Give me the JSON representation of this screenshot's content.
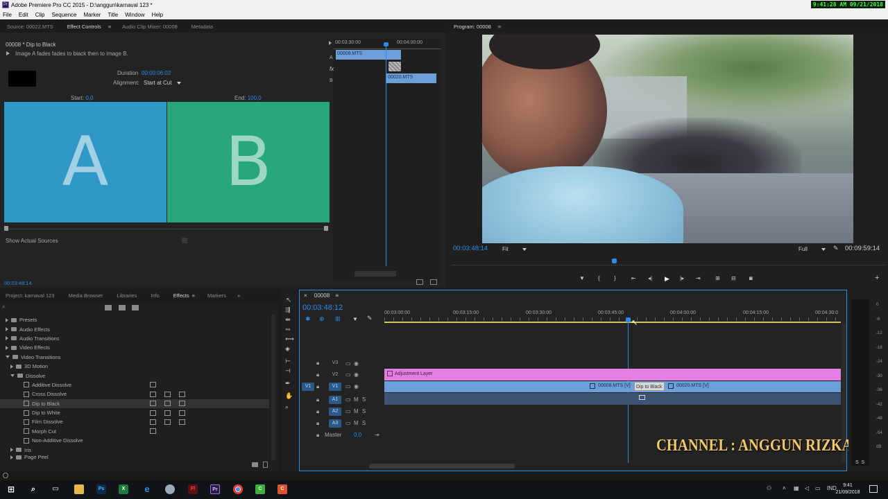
{
  "window": {
    "title": "Adobe Premiere Pro CC 2015 - D:\\anggun\\karnaval 123 *",
    "clock": "9:41:28 AM 09/21/2018",
    "app_badge": "Pr"
  },
  "menu": [
    "File",
    "Edit",
    "Clip",
    "Sequence",
    "Marker",
    "Title",
    "Window",
    "Help"
  ],
  "source_panel": {
    "tabs": [
      "Source: 00022.MTS",
      "Effect Controls",
      "Audio Clip Mixer: 00008",
      "Metadata"
    ],
    "clip_title": "00008 * Dip to Black",
    "description": "Image A fades fades to black then to image B.",
    "duration_label": "Duration",
    "duration_value": "00:00:06:02",
    "alignment_label": "Alignment:",
    "alignment_value": "Start at Cut",
    "start_label": "Start:",
    "start_value": "0,0",
    "end_label": "End:",
    "end_value": "100,0",
    "preview_a": "A",
    "preview_b": "B",
    "show_actual_sources": "Show Actual Sources",
    "mini_timeline_times": [
      "00:03:30:00",
      "00:04:00:00"
    ],
    "track_a_label": "A",
    "track_b_label": "B",
    "fx_label": "fx",
    "clip_a": "00008.MTS",
    "clip_b": "00020.MTS",
    "timecode": "00:03:48:14"
  },
  "program_panel": {
    "tab": "Program: 00008",
    "timecode_left": "00:03:48:14",
    "fit": "Fit",
    "quality": "Full",
    "timecode_right": "00:09:59:14",
    "controls": [
      "marker-icon",
      "in-point-icon",
      "out-point-icon",
      "go-to-in-icon",
      "step-back-icon",
      "play-icon",
      "step-forward-icon",
      "go-to-out-icon",
      "lift-icon",
      "extract-icon",
      "export-frame-icon"
    ]
  },
  "project_panel": {
    "tabs": [
      "Project: karnaval 123",
      "Media Browser",
      "Libraries",
      "Info",
      "Effects",
      "Markers"
    ],
    "active_tab": "Effects",
    "tree": [
      {
        "label": "Presets",
        "level": 0,
        "type": "folder",
        "state": "closed"
      },
      {
        "label": "Audio Effects",
        "level": 0,
        "type": "folder",
        "state": "closed"
      },
      {
        "label": "Audio Transitions",
        "level": 0,
        "type": "folder",
        "state": "closed"
      },
      {
        "label": "Video Effects",
        "level": 0,
        "type": "folder",
        "state": "closed"
      },
      {
        "label": "Video Transitions",
        "level": 0,
        "type": "folder",
        "state": "open"
      },
      {
        "label": "3D Motion",
        "level": 1,
        "type": "folder",
        "state": "closed"
      },
      {
        "label": "Dissolve",
        "level": 1,
        "type": "folder",
        "state": "open"
      },
      {
        "label": "Additive Dissolve",
        "level": 2,
        "type": "effect",
        "badges": 1
      },
      {
        "label": "Cross Dissolve",
        "level": 2,
        "type": "effect",
        "badges": 3
      },
      {
        "label": "Dip to Black",
        "level": 2,
        "type": "effect",
        "badges": 3,
        "selected": true
      },
      {
        "label": "Dip to White",
        "level": 2,
        "type": "effect",
        "badges": 3
      },
      {
        "label": "Film Dissolve",
        "level": 2,
        "type": "effect",
        "badges": 3
      },
      {
        "label": "Morph Cut",
        "level": 2,
        "type": "effect",
        "badges": 1
      },
      {
        "label": "Non-Additive Dissolve",
        "level": 2,
        "type": "effect",
        "badges": 0
      },
      {
        "label": "Iris",
        "level": 1,
        "type": "folder",
        "state": "closed"
      },
      {
        "label": "Page Peel",
        "level": 1,
        "type": "folder",
        "state": "closed"
      }
    ]
  },
  "timeline": {
    "tab": "00008",
    "timecode": "00:03:48:12",
    "ruler": [
      "00:03:00:00",
      "00:03:15:00",
      "00:03:30:00",
      "00:03:45:00",
      "00:04:00:00",
      "00:04:15:00",
      "00:04:30:0"
    ],
    "video_tracks": [
      "V3",
      "V2",
      "V1"
    ],
    "audio_tracks": [
      "A1",
      "A2",
      "A3"
    ],
    "source_patch_v": "V1",
    "master_label": "Master",
    "master_value": "0,0",
    "adjustment_layer": "Adjustment Layer",
    "clip_left": "00008.MTS [V]",
    "clip_right": "00020.MTS [V]",
    "transition_tooltip": "Dip to Black",
    "mute": "M",
    "solo": "S"
  },
  "overlay": {
    "channel": "CHANNEL : ANGGUN RIZKA"
  },
  "meters": {
    "labels": [
      "0",
      "-6",
      "-12",
      "-18",
      "-24",
      "-30",
      "-36",
      "-42",
      "-48",
      "-54",
      "dB"
    ],
    "footer": "S  S"
  },
  "taskbar": {
    "apps": [
      "start",
      "search",
      "task-view",
      "explorer",
      "photoshop",
      "excel",
      "edge",
      "app",
      "flash",
      "premiere",
      "chrome",
      "camtasia",
      "recorder"
    ],
    "lang": "IND",
    "time": "9:41",
    "date": "21/09/2018"
  },
  "colors": {
    "accent": "#2d8ceb",
    "clip_blue": "#6c9fd8",
    "adjustment": "#e37fe0",
    "preview_a": "#2f98c6",
    "preview_b": "#27a77b"
  }
}
